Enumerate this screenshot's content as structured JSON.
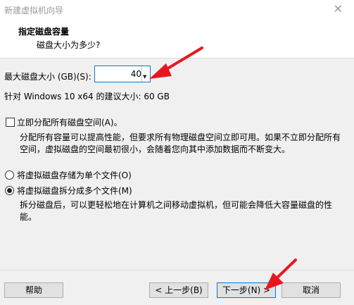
{
  "window": {
    "title": "新建虚拟机向导"
  },
  "header": {
    "title": "指定磁盘容量",
    "subtitle": "磁盘大小为多少?"
  },
  "disk_size": {
    "label": "最大磁盘大小 (GB)(S):",
    "value": "40"
  },
  "recommend": {
    "text": "针对 Windows 10 x64 的建议大小: 60 GB"
  },
  "allocate_now": {
    "label": "立即分配所有磁盘空间(A)。",
    "checked": false,
    "description": "分配所有容量可以提高性能，但要求所有物理磁盘空间立即可用。如果不立即分配所有空间，虚拟磁盘的空间最初很小，会随着您向其中添加数据而不断变大。"
  },
  "options": [
    {
      "label": "将虚拟磁盘存储为单个文件(O)",
      "selected": false
    },
    {
      "label": "将虚拟磁盘拆分成多个文件(M)",
      "selected": true
    }
  ],
  "split_description": "拆分磁盘后，可以更轻松地在计算机之间移动虚拟机，但可能会降低大容量磁盘的性能。",
  "buttons": {
    "help": "帮助",
    "back": "< 上一步(B)",
    "next": "下一步(N) >",
    "cancel": "取消"
  },
  "colors": {
    "annotation_arrow": "#e8171f",
    "focus_border": "#0078d7",
    "panel_bg": "#f0f0f0"
  }
}
